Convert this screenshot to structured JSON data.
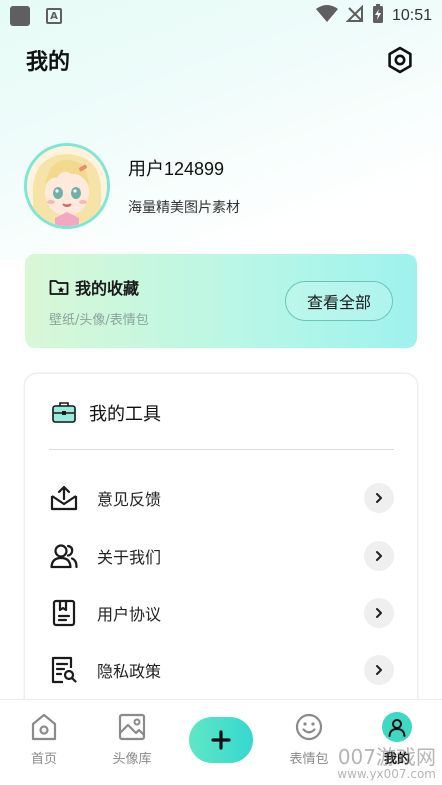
{
  "status_bar": {
    "left_icons": [
      "notification-square-icon",
      "a-text-icon"
    ],
    "right_icons": [
      "wifi-icon",
      "no-signal-icon",
      "battery-charging-icon"
    ],
    "time": "10:51"
  },
  "header": {
    "title": "我的",
    "settings_icon": "settings-icon"
  },
  "profile": {
    "avatar_icon": "avatar-image",
    "username": "用户124899",
    "description": "海量精美图片素材"
  },
  "favorites": {
    "icon": "folder-star-icon",
    "title": "我的收藏",
    "subtitle": "壁纸/头像/表情包",
    "view_all_label": "查看全部",
    "colors": {
      "start": "#d9f7d6",
      "end": "#9ef2ee",
      "border": "#6cc3b7"
    }
  },
  "tools": {
    "icon": "toolbox-icon",
    "title": "我的工具",
    "items": [
      {
        "label": "意见反馈",
        "icon": "feedback-inbox-icon"
      },
      {
        "label": "关于我们",
        "icon": "users-icon"
      },
      {
        "label": "用户协议",
        "icon": "agreement-document-icon"
      },
      {
        "label": "隐私政策",
        "icon": "privacy-document-icon"
      }
    ]
  },
  "bottom_nav": {
    "items": [
      {
        "label": "首页",
        "icon": "home-icon",
        "active": false
      },
      {
        "label": "头像库",
        "icon": "image-icon",
        "active": false
      },
      {
        "label": "",
        "icon": "plus-icon",
        "active": false
      },
      {
        "label": "表情包",
        "icon": "smiley-icon",
        "active": false
      },
      {
        "label": "我的",
        "icon": "user-icon",
        "active": true
      }
    ],
    "accent_color": "#3fd8c2"
  },
  "watermark": {
    "line1": "007游戏网",
    "line2": "www.yx007.com"
  }
}
